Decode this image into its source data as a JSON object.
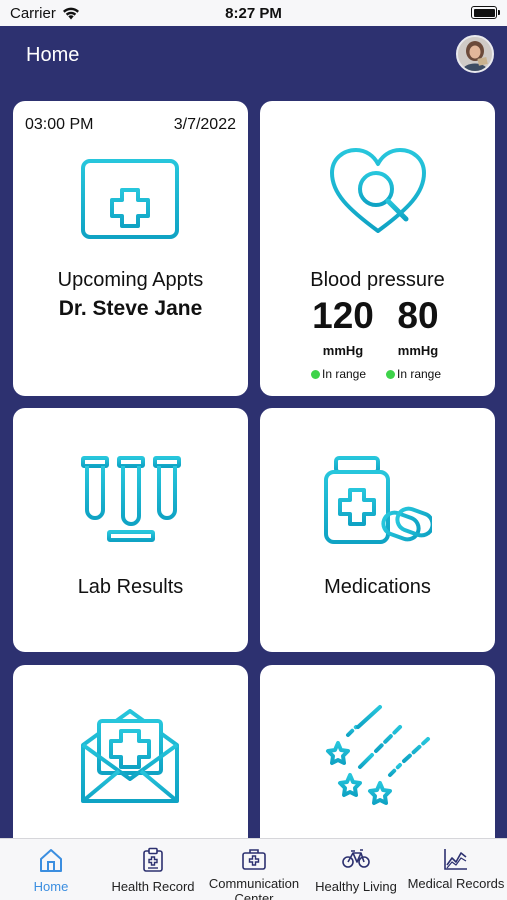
{
  "status_bar": {
    "carrier": "Carrier",
    "time": "8:27 PM"
  },
  "header": {
    "title": "Home"
  },
  "colors": {
    "brand_navy": "#2d3170",
    "icon_teal": "#1db7cf",
    "status_green": "#3ed34a",
    "tab_active": "#3b8ee0"
  },
  "cards": {
    "appointments": {
      "time": "03:00 PM",
      "date": "3/7/2022",
      "icon": "calendar-plus-icon",
      "title": "Upcoming Appts",
      "doctor": "Dr. Steve Jane"
    },
    "blood_pressure": {
      "icon": "heart-search-icon",
      "title": "Blood pressure",
      "systolic": "120",
      "diastolic": "80",
      "systolic_unit": "mmHg",
      "diastolic_unit": "mmHg",
      "systolic_status": "In range",
      "diastolic_status": "In range"
    },
    "lab_results": {
      "icon": "test-tubes-icon",
      "title": "Lab Results"
    },
    "medications": {
      "icon": "medicine-bottle-icon",
      "title": "Medications"
    },
    "messages": {
      "icon": "medical-envelope-icon"
    },
    "wellness": {
      "icon": "shooting-stars-icon"
    }
  },
  "tabs": [
    {
      "label": "Home",
      "icon": "home-icon",
      "active": true
    },
    {
      "label": "Health Record",
      "icon": "clipboard-icon",
      "active": false
    },
    {
      "label": "Communication Center",
      "icon": "medical-bag-icon",
      "active": false
    },
    {
      "label": "Healthy Living",
      "icon": "bicycle-icon",
      "active": false
    },
    {
      "label": "Medical Records",
      "icon": "chart-icon",
      "active": false
    }
  ]
}
